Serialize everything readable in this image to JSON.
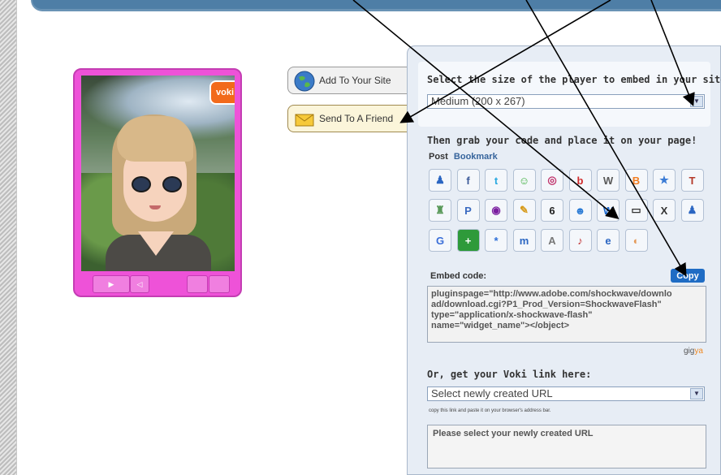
{
  "player": {
    "badge": "voki",
    "controls": [
      "▶",
      "◁"
    ]
  },
  "side_buttons": {
    "add_label": "Add To Your Site",
    "send_label": "Send To A Friend"
  },
  "embed_panel": {
    "size_prompt": "Select the size of the player to embed in your site:",
    "size_selected": "Medium (200 x 267)",
    "grab_prompt": "Then grab your code and place it on your page!",
    "tabs": [
      "Post",
      "Bookmark"
    ],
    "share_icons": [
      {
        "name": "myspace-icon",
        "glyph": "♟",
        "color": "#2b66c2"
      },
      {
        "name": "facebook-icon",
        "glyph": "f",
        "color": "#3b5998"
      },
      {
        "name": "twitter-icon",
        "glyph": "t",
        "color": "#2aa9e0"
      },
      {
        "name": "smiley-icon",
        "glyph": "☺",
        "color": "#3cae3c"
      },
      {
        "name": "circle-icon",
        "glyph": "◎",
        "color": "#c0336b"
      },
      {
        "name": "blogger-b-icon",
        "glyph": "b",
        "color": "#d12c2c"
      },
      {
        "name": "wordpress-icon",
        "glyph": "W",
        "color": "#5a5a5a"
      },
      {
        "name": "blogger-icon",
        "glyph": "B",
        "color": "#f27d21"
      },
      {
        "name": "star-icon",
        "glyph": "★",
        "color": "#3a7bd5"
      },
      {
        "name": "typepad-icon",
        "glyph": "T",
        "color": "#b43a2a"
      },
      {
        "name": "people-icon",
        "glyph": "♜",
        "color": "#5a9a5a"
      },
      {
        "name": "p-icon",
        "glyph": "P",
        "color": "#3a6ac0"
      },
      {
        "name": "yahoo-icon",
        "glyph": "◉",
        "color": "#7a1ea0"
      },
      {
        "name": "pen-icon",
        "glyph": "✎",
        "color": "#d79a1a"
      },
      {
        "name": "six-icon",
        "glyph": "6",
        "color": "#222222"
      },
      {
        "name": "face-icon",
        "glyph": "☻",
        "color": "#2b7bd5"
      },
      {
        "name": "windows-live-icon",
        "glyph": "W",
        "color": "#1e6bd0"
      },
      {
        "name": "chat-icon",
        "glyph": "▭",
        "color": "#333333"
      },
      {
        "name": "x-icon",
        "glyph": "X",
        "color": "#333333"
      },
      {
        "name": "user-icon",
        "glyph": "♟",
        "color": "#2b66c2"
      },
      {
        "name": "google-icon",
        "glyph": "G",
        "color": "#3a6ed8"
      },
      {
        "name": "plus-icon",
        "glyph": "+",
        "color": "#ffffff"
      },
      {
        "name": "asterisk-icon",
        "glyph": "*",
        "color": "#2d6fd8"
      },
      {
        "name": "mi-icon",
        "glyph": "m",
        "color": "#2b66c2"
      },
      {
        "name": "ameba-icon",
        "glyph": "A",
        "color": "#777777"
      },
      {
        "name": "music-icon",
        "glyph": "♪",
        "color": "#c03030"
      },
      {
        "name": "e-icon",
        "glyph": "e",
        "color": "#2b66c2"
      },
      {
        "name": "shell-icon",
        "glyph": "◐",
        "color": "#e49a5a"
      }
    ],
    "embed_label": "Embed code:",
    "copy_label": "Copy",
    "code_lines": [
      "pluginspage=\"http://www.adobe.com/shockwave/downlo",
      "ad/download.cgi?P1_Prod_Version=ShockwaveFlash\"",
      "type=\"application/x-shockwave-flash\"",
      "name=\"widget_name\"></object>"
    ],
    "gigya_prefix": "gig",
    "gigya_suffix": "ya",
    "link_prompt": "Or, get your Voki link here:",
    "url_select": "Select newly created URL",
    "copy_note": "copy this link and paste it on your browser's address bar.",
    "url_box": "Please select your newly created URL"
  }
}
